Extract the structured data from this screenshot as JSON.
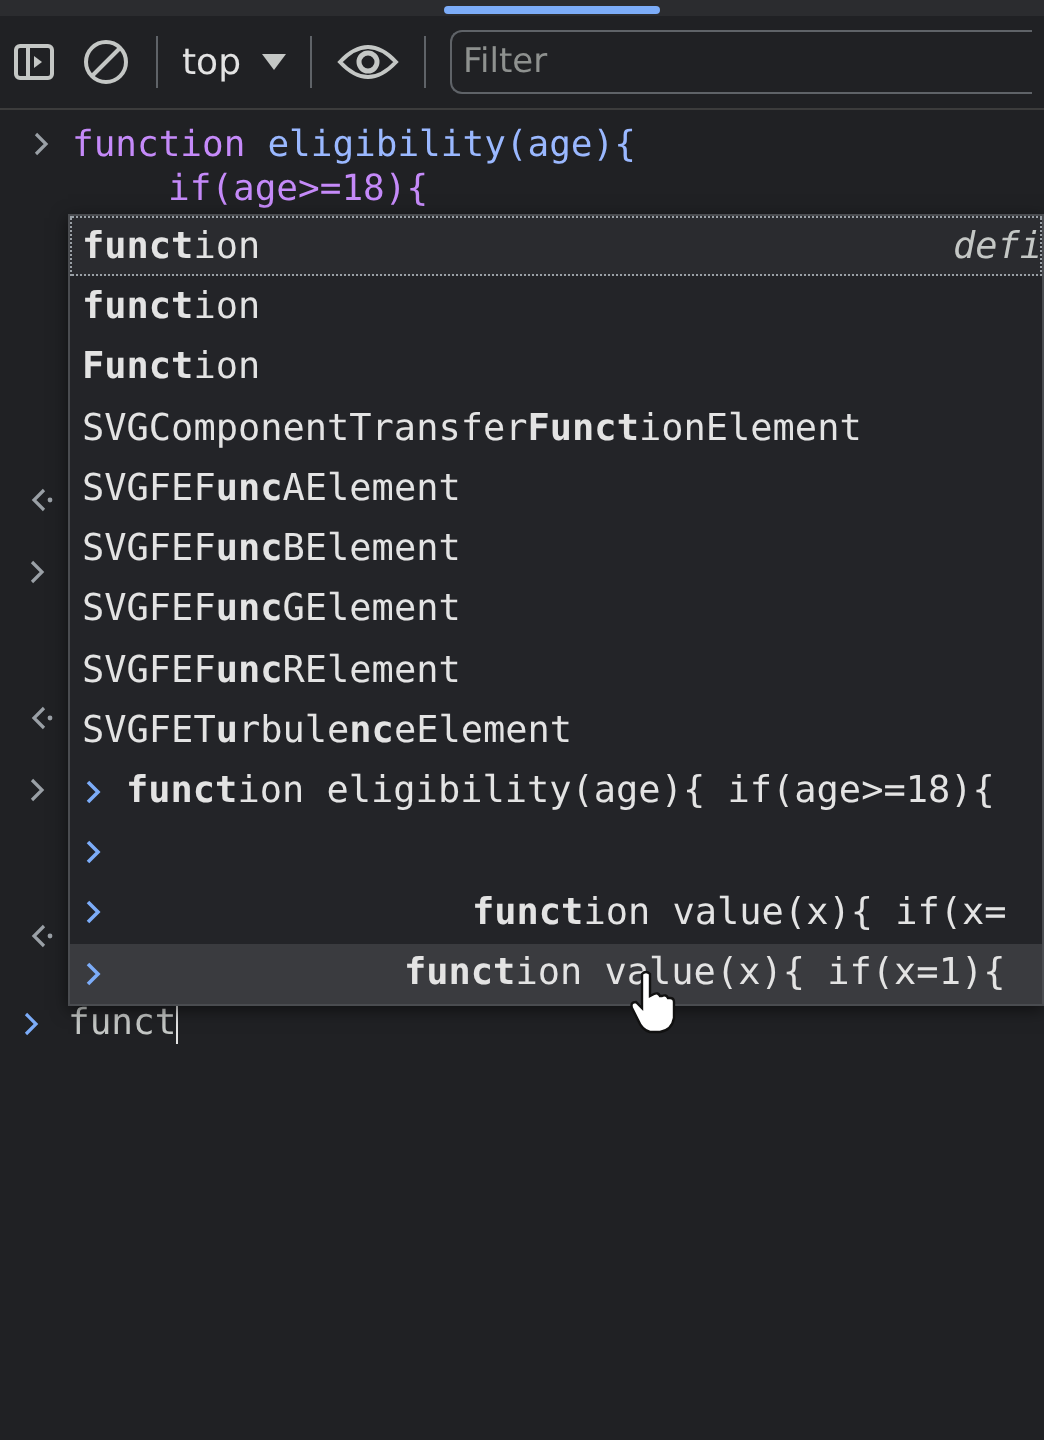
{
  "toolbar": {
    "context": "top",
    "filter": {
      "placeholder": "Filter"
    }
  },
  "console": {
    "lines": [
      [
        {
          "kind": "keyword",
          "text": "function"
        },
        {
          "kind": "name",
          "text": "eligibility(age){"
        }
      ],
      [
        {
          "kind": "keyword",
          "text": "if(age>=18){"
        }
      ]
    ],
    "gutter": [
      {
        "kind": "blank"
      },
      {
        "kind": "blank"
      },
      {
        "kind": "blank"
      },
      {
        "kind": "result"
      },
      {
        "kind": "input"
      },
      {
        "kind": "blank"
      },
      {
        "kind": "result"
      },
      {
        "kind": "input"
      },
      {
        "kind": "blank"
      },
      {
        "kind": "result"
      }
    ],
    "prompt": {
      "value": "funct"
    }
  },
  "autocomplete": {
    "suggestions": [
      {
        "text": "**funct**ion",
        "hint": "defi",
        "selected": true
      },
      {
        "text": "**funct**ion",
        "selected": false
      },
      {
        "text": "**Funct**ion",
        "selected": false
      },
      {
        "text": "SVGComponentTransfer**Funct**ionElement",
        "selected": false
      },
      {
        "text": "SVGFEF**unc**AElement",
        "selected": false
      },
      {
        "text": "SVGFEF**unc**BElement",
        "selected": false
      },
      {
        "text": "SVGFEF**unc**GElement",
        "selected": false
      },
      {
        "text": "SVGFEF**unc**RElement",
        "selected": false
      },
      {
        "text": "SVGFET**u**rbule**nc**eElement",
        "selected": false
      }
    ],
    "history": [
      {
        "text": "**funct**ion eligibility(age){ if(age>=18){",
        "selected": false
      },
      {
        "selected": false
      },
      {
        "text": "**funct**ion value(x){ if(x=",
        "selected": false
      },
      {
        "text": "**funct**ion value(x){ if(x=1){",
        "selected": true
      }
    ]
  }
}
